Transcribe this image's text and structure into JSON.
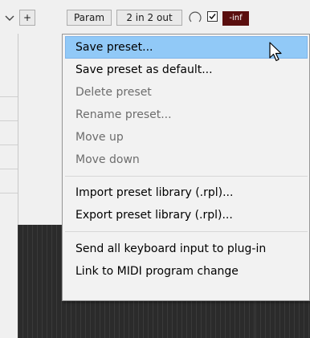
{
  "toolbar": {
    "add_label": "+",
    "param_label": "Param",
    "io_label": "2 in 2 out",
    "volume_label": "-inf"
  },
  "menu": {
    "items": [
      {
        "label": "Save preset...",
        "enabled": true,
        "highlighted": true
      },
      {
        "label": "Save preset as default...",
        "enabled": true
      },
      {
        "label": "Delete preset",
        "enabled": false
      },
      {
        "label": "Rename preset...",
        "enabled": false
      },
      {
        "label": "Move up",
        "enabled": false
      },
      {
        "label": "Move down",
        "enabled": false
      },
      {
        "label": "Import preset library (.rpl)...",
        "enabled": true
      },
      {
        "label": "Export preset library (.rpl)...",
        "enabled": true
      },
      {
        "label": "Send all keyboard input to plug-in",
        "enabled": true
      },
      {
        "label": "Link to MIDI program change",
        "enabled": true
      }
    ]
  },
  "colors": {
    "menu_highlight": "#91c9f7",
    "disabled_text": "#6d6d6d",
    "inf_background": "#5a0f0f",
    "meter_background": "#2b2b2b"
  }
}
